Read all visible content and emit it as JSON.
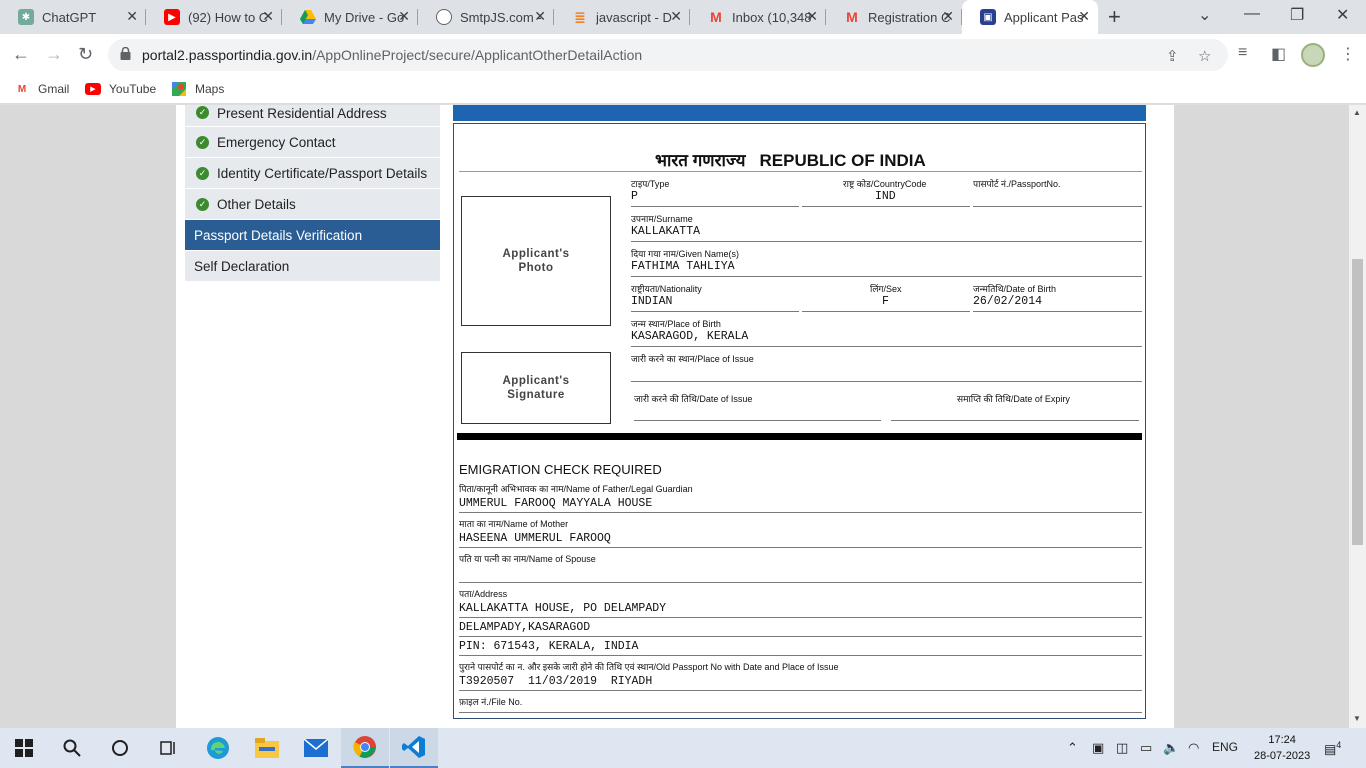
{
  "tabs": [
    {
      "title": "ChatGPT",
      "icon": "chatgpt-icon",
      "color": "#74aa9c"
    },
    {
      "title": "(92) How to C",
      "icon": "youtube-icon",
      "color": "#ff0000"
    },
    {
      "title": "My Drive - Go",
      "icon": "drive-icon",
      "color": "#fbbc04"
    },
    {
      "title": "SmtpJS.com -",
      "icon": "globe-icon",
      "color": "#5f6368"
    },
    {
      "title": "javascript - D",
      "icon": "stackoverflow-icon",
      "color": "#f48024"
    },
    {
      "title": "Inbox (10,348",
      "icon": "gmail-icon",
      "color": "#ea4335"
    },
    {
      "title": "Registration C",
      "icon": "gmail-icon",
      "color": "#ea4335"
    },
    {
      "title": "Applicant Pas",
      "icon": "passport-seva-icon",
      "color": "#2a3f8f"
    }
  ],
  "address": {
    "host": "portal2.passportindia.gov.in",
    "path": "/AppOnlineProject/secure/ApplicantOtherDetailAction"
  },
  "bookmarks": [
    {
      "label": "Gmail",
      "icon": "gmail-icon"
    },
    {
      "label": "YouTube",
      "icon": "youtube-icon"
    },
    {
      "label": "Maps",
      "icon": "maps-icon"
    }
  ],
  "sidebar": {
    "items": [
      {
        "label": "Present Residential Address",
        "done": true
      },
      {
        "label": "Emergency Contact",
        "done": true
      },
      {
        "label": "Identity Certificate/Passport Details",
        "done": true
      },
      {
        "label": "Other Details",
        "done": true
      },
      {
        "label": "Passport Details Verification",
        "done": false,
        "active": true
      },
      {
        "label": "Self Declaration",
        "done": false
      }
    ]
  },
  "passport": {
    "republic_hi": "भारत गणराज्य",
    "republic_en": "REPUBLIC OF INDIA",
    "photo_label": "Applicant's Photo",
    "signature_label": "Applicant's Signature",
    "type_label": "टाइप/Type",
    "type": "P",
    "country_label": "राष्ट्र कोड/CountryCode",
    "country": "IND",
    "passport_no_label": "पासपोर्ट नं./PassportNo.",
    "passport_no": "",
    "surname_label": "उपनाम/Surname",
    "surname": "KALLAKATTA",
    "given_label": "दिया गया नाम/Given Name(s)",
    "given": "FATHIMA TAHLIYA",
    "nationality_label": "राष्ट्रीयता/Nationality",
    "nationality": "INDIAN",
    "sex_label": "लिंग/Sex",
    "sex": "F",
    "dob_label": "जन्मतिथि/Date of Birth",
    "dob": "26/02/2014",
    "pob_label": "जन्म स्थान/Place of Birth",
    "pob": "KASARAGOD, KERALA",
    "poi_label": "जारी करने का स्थान/Place of Issue",
    "poi": "",
    "doi_label": "जारी करने की तिथि/Date of Issue",
    "doi": "",
    "doe_label": "समाप्ति की तिथि/Date of Expiry",
    "doe": ""
  },
  "other": {
    "emigration": "EMIGRATION CHECK REQUIRED",
    "father_label": "पिता/कानूनी अभिभावक का नाम/Name of Father/Legal Guardian",
    "father": "UMMERUL FAROOQ MAYYALA HOUSE",
    "mother_label": "माता का नाम/Name of Mother",
    "mother": "HASEENA UMMERUL FAROOQ",
    "spouse_label": "पति या पत्नी का नाम/Name of Spouse",
    "spouse": "",
    "address_label": "पता/Address",
    "address1": "KALLAKATTA HOUSE, PO DELAMPADY",
    "address2": "DELAMPADY,KASARAGOD",
    "address3": "PIN: 671543, KERALA, INDIA",
    "oldpp_label": "पुराने पासपोर्ट का न. और इसके जारी होने की तिथि एवं स्थान/Old Passport No with Date and Place of Issue",
    "oldpp": "T3920507  11/03/2019  RIYADH",
    "file_label": "फ़ाइल नं./File No."
  },
  "taskbar": {
    "lang": "ENG",
    "time": "17:24",
    "date": "28-07-2023",
    "notifications": "4"
  }
}
